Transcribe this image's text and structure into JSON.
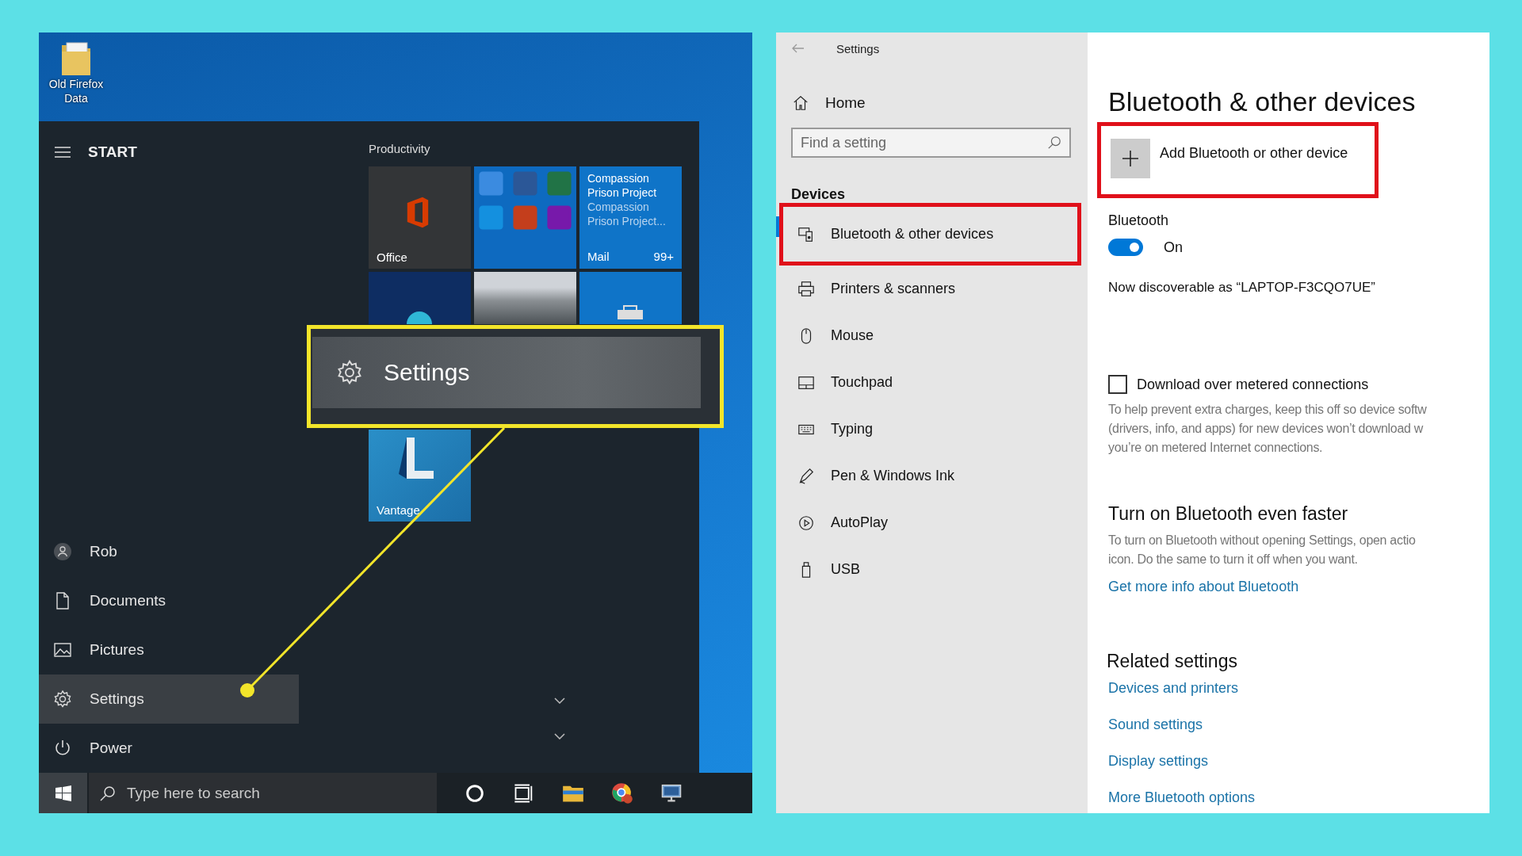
{
  "desktop": {
    "icon_label": "Old Firefox Data"
  },
  "start_menu": {
    "title": "START",
    "group_title": "Productivity",
    "items": [
      {
        "kind": "avatar",
        "label": "Rob",
        "selected": false
      },
      {
        "kind": "document",
        "label": "Documents",
        "selected": false
      },
      {
        "kind": "picture",
        "label": "Pictures",
        "selected": false
      },
      {
        "kind": "gear",
        "label": "Settings",
        "selected": true
      },
      {
        "kind": "power",
        "label": "Power",
        "selected": false
      }
    ],
    "tiles": [
      {
        "kind": "office",
        "label": "Office"
      },
      {
        "kind": "apps"
      },
      {
        "kind": "mail",
        "title": "Compassion Prison Project",
        "subtitle": "Compassion Prison Project...",
        "label": "Mail",
        "badge": "99+"
      },
      {
        "kind": "browser"
      },
      {
        "kind": "photo"
      },
      {
        "kind": "store"
      },
      {
        "kind": "vantage",
        "label": "Vantage"
      }
    ]
  },
  "callout": {
    "label": "Settings"
  },
  "taskbar": {
    "search_placeholder": "Type here to search"
  },
  "settings_window": {
    "title": "Settings",
    "home": "Home",
    "search_placeholder": "Find a setting",
    "section": "Devices",
    "nav": [
      {
        "kind": "bluetooth",
        "label": "Bluetooth & other devices",
        "selected": true,
        "annotated": true
      },
      {
        "kind": "printer",
        "label": "Printers & scanners",
        "selected": false,
        "annotated": false
      },
      {
        "kind": "mouse",
        "label": "Mouse",
        "selected": false,
        "annotated": false
      },
      {
        "kind": "touchpad",
        "label": "Touchpad",
        "selected": false,
        "annotated": false
      },
      {
        "kind": "keyboard",
        "label": "Typing",
        "selected": false,
        "annotated": false
      },
      {
        "kind": "pen",
        "label": "Pen & Windows Ink",
        "selected": false,
        "annotated": false
      },
      {
        "kind": "autoplay",
        "label": "AutoPlay",
        "selected": false,
        "annotated": false
      },
      {
        "kind": "usb",
        "label": "USB",
        "selected": false,
        "annotated": false
      }
    ],
    "heading": "Bluetooth & other devices",
    "add_device": {
      "label": "Add Bluetooth or other device",
      "annotated": true
    },
    "bluetooth": {
      "label": "Bluetooth",
      "on": true,
      "state_text": "On"
    },
    "discoverable": "Now discoverable as “LAPTOP-F3CQO7UE”",
    "metered": {
      "label": "Download over metered connections",
      "checked": false,
      "help_lines": [
        "To help prevent extra charges, keep this off so device softw",
        "(drivers, info, and apps) for new devices won’t download w",
        "you’re on metered Internet connections."
      ]
    },
    "faster": {
      "heading": "Turn on Bluetooth even faster",
      "lines": [
        "To turn on Bluetooth without opening Settings, open actio",
        "icon. Do the same to turn it off when you want."
      ],
      "link": "Get more info about Bluetooth"
    },
    "related": {
      "heading": "Related settings",
      "links": [
        "Devices and printers",
        "Sound settings",
        "Display settings",
        "More Bluetooth options"
      ]
    }
  }
}
